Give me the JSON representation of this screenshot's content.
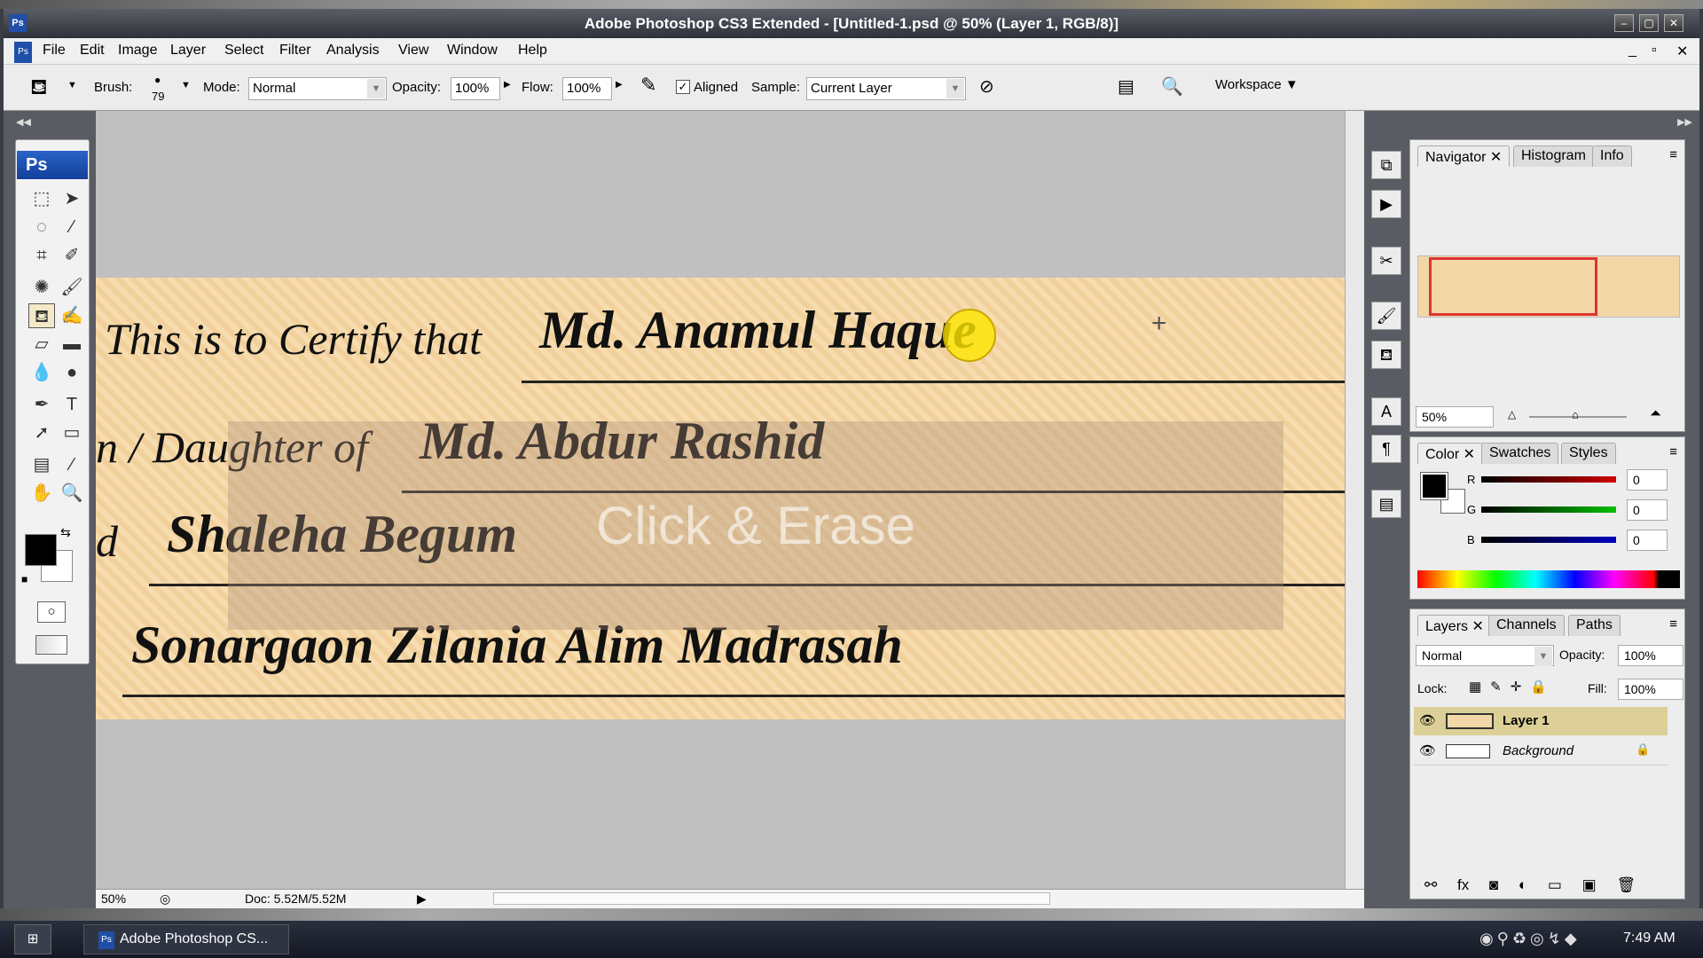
{
  "window": {
    "title": "Adobe Photoshop CS3 Extended - [Untitled-1.psd @ 50% (Layer 1, RGB/8)]",
    "app_icon": "Ps"
  },
  "menu": [
    "File",
    "Edit",
    "Image",
    "Layer",
    "Select",
    "Filter",
    "Analysis",
    "View",
    "Window",
    "Help"
  ],
  "options": {
    "brush_label": "Brush:",
    "brush_size": "79",
    "mode_label": "Mode:",
    "mode": "Normal",
    "opacity_label": "Opacity:",
    "opacity": "100%",
    "flow_label": "Flow:",
    "flow": "100%",
    "aligned_label": "Aligned",
    "aligned": true,
    "sample_label": "Sample:",
    "sample": "Current Layer",
    "workspace": "Workspace ▼"
  },
  "toolbox": {
    "logo": "Ps",
    "tools": [
      "marquee-icon",
      "move-icon",
      "lasso-icon",
      "magic-wand-icon",
      "crop-icon",
      "slice-icon",
      "healing-icon",
      "brush-icon",
      "clone-stamp-icon",
      "history-brush-icon",
      "eraser-icon",
      "gradient-icon",
      "blur-icon",
      "dodge-icon",
      "pen-icon",
      "type-icon",
      "path-select-icon",
      "shape-icon",
      "notes-icon",
      "eyedropper-icon",
      "hand-icon",
      "zoom-icon"
    ]
  },
  "document": {
    "line1_label": "This is to Certify that",
    "line1_value": "Md. Anamul Haque",
    "line2_label": "n / Daughter of",
    "line2_value": "Md. Abdur Rashid",
    "line3_label": "d",
    "line3_value": "Shaleha Begum",
    "line4_value": "Sonargaon Zilania Alim Madrasah",
    "overlay": "Click & Erase"
  },
  "status": {
    "zoom": "50%",
    "doc": "Doc: 5.52M/5.52M"
  },
  "navigator": {
    "tabs": [
      "Navigator",
      "Histogram",
      "Info"
    ],
    "zoom": "50%"
  },
  "color": {
    "tabs": [
      "Color",
      "Swatches",
      "Styles"
    ],
    "channels": [
      {
        "label": "R",
        "value": "0",
        "color": "#d00000"
      },
      {
        "label": "G",
        "value": "0",
        "color": "#00c000"
      },
      {
        "label": "B",
        "value": "0",
        "color": "#0000c0"
      }
    ],
    "foreground": "#000000",
    "background": "#ffffff"
  },
  "layers": {
    "tabs": [
      "Layers",
      "Channels",
      "Paths"
    ],
    "blend": "Normal",
    "opacity_label": "Opacity:",
    "opacity": "100%",
    "lock_label": "Lock:",
    "fill_label": "Fill:",
    "fill": "100%",
    "items": [
      {
        "name": "Layer 1",
        "selected": true
      },
      {
        "name": "Background",
        "locked": true
      }
    ]
  },
  "taskbar": {
    "task": "Adobe Photoshop CS...",
    "clock": "7:49 AM"
  }
}
